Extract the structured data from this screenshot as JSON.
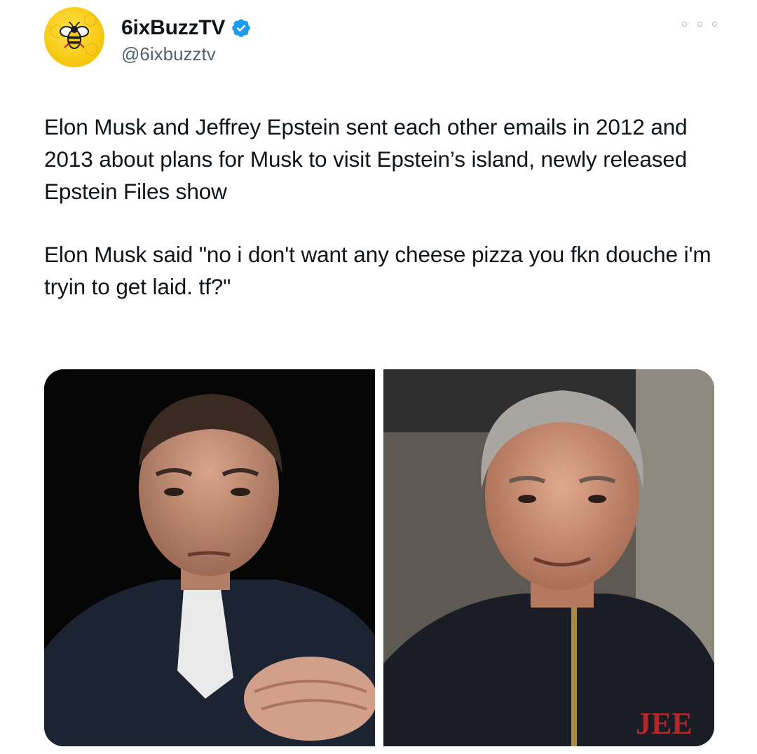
{
  "tweet": {
    "author": {
      "display_name": "6ixBuzzTV",
      "handle": "@6ixbuzztv",
      "verified": true,
      "avatar_icon": "bee-logo-icon",
      "avatar_color": "#f7c914"
    },
    "more_icon": "more-options-icon",
    "text_paragraphs": [
      "Elon Musk and Jeffrey Epstein sent each other emails in 2012 and 2013 about plans for Musk to visit Epstein’s island, newly released Epstein Files show",
      "Elon Musk said \"no i don't want any cheese pizza you fkn douche i'm tryin to get laid. tf?\""
    ],
    "media": [
      {
        "name": "photo-left",
        "description_icon": "person-photo-icon"
      },
      {
        "name": "photo-right",
        "description_icon": "person-photo-icon"
      }
    ],
    "colors": {
      "text": "#0f1419",
      "secondary_text": "#536471",
      "verified_badge": "#1d9bf0"
    }
  }
}
